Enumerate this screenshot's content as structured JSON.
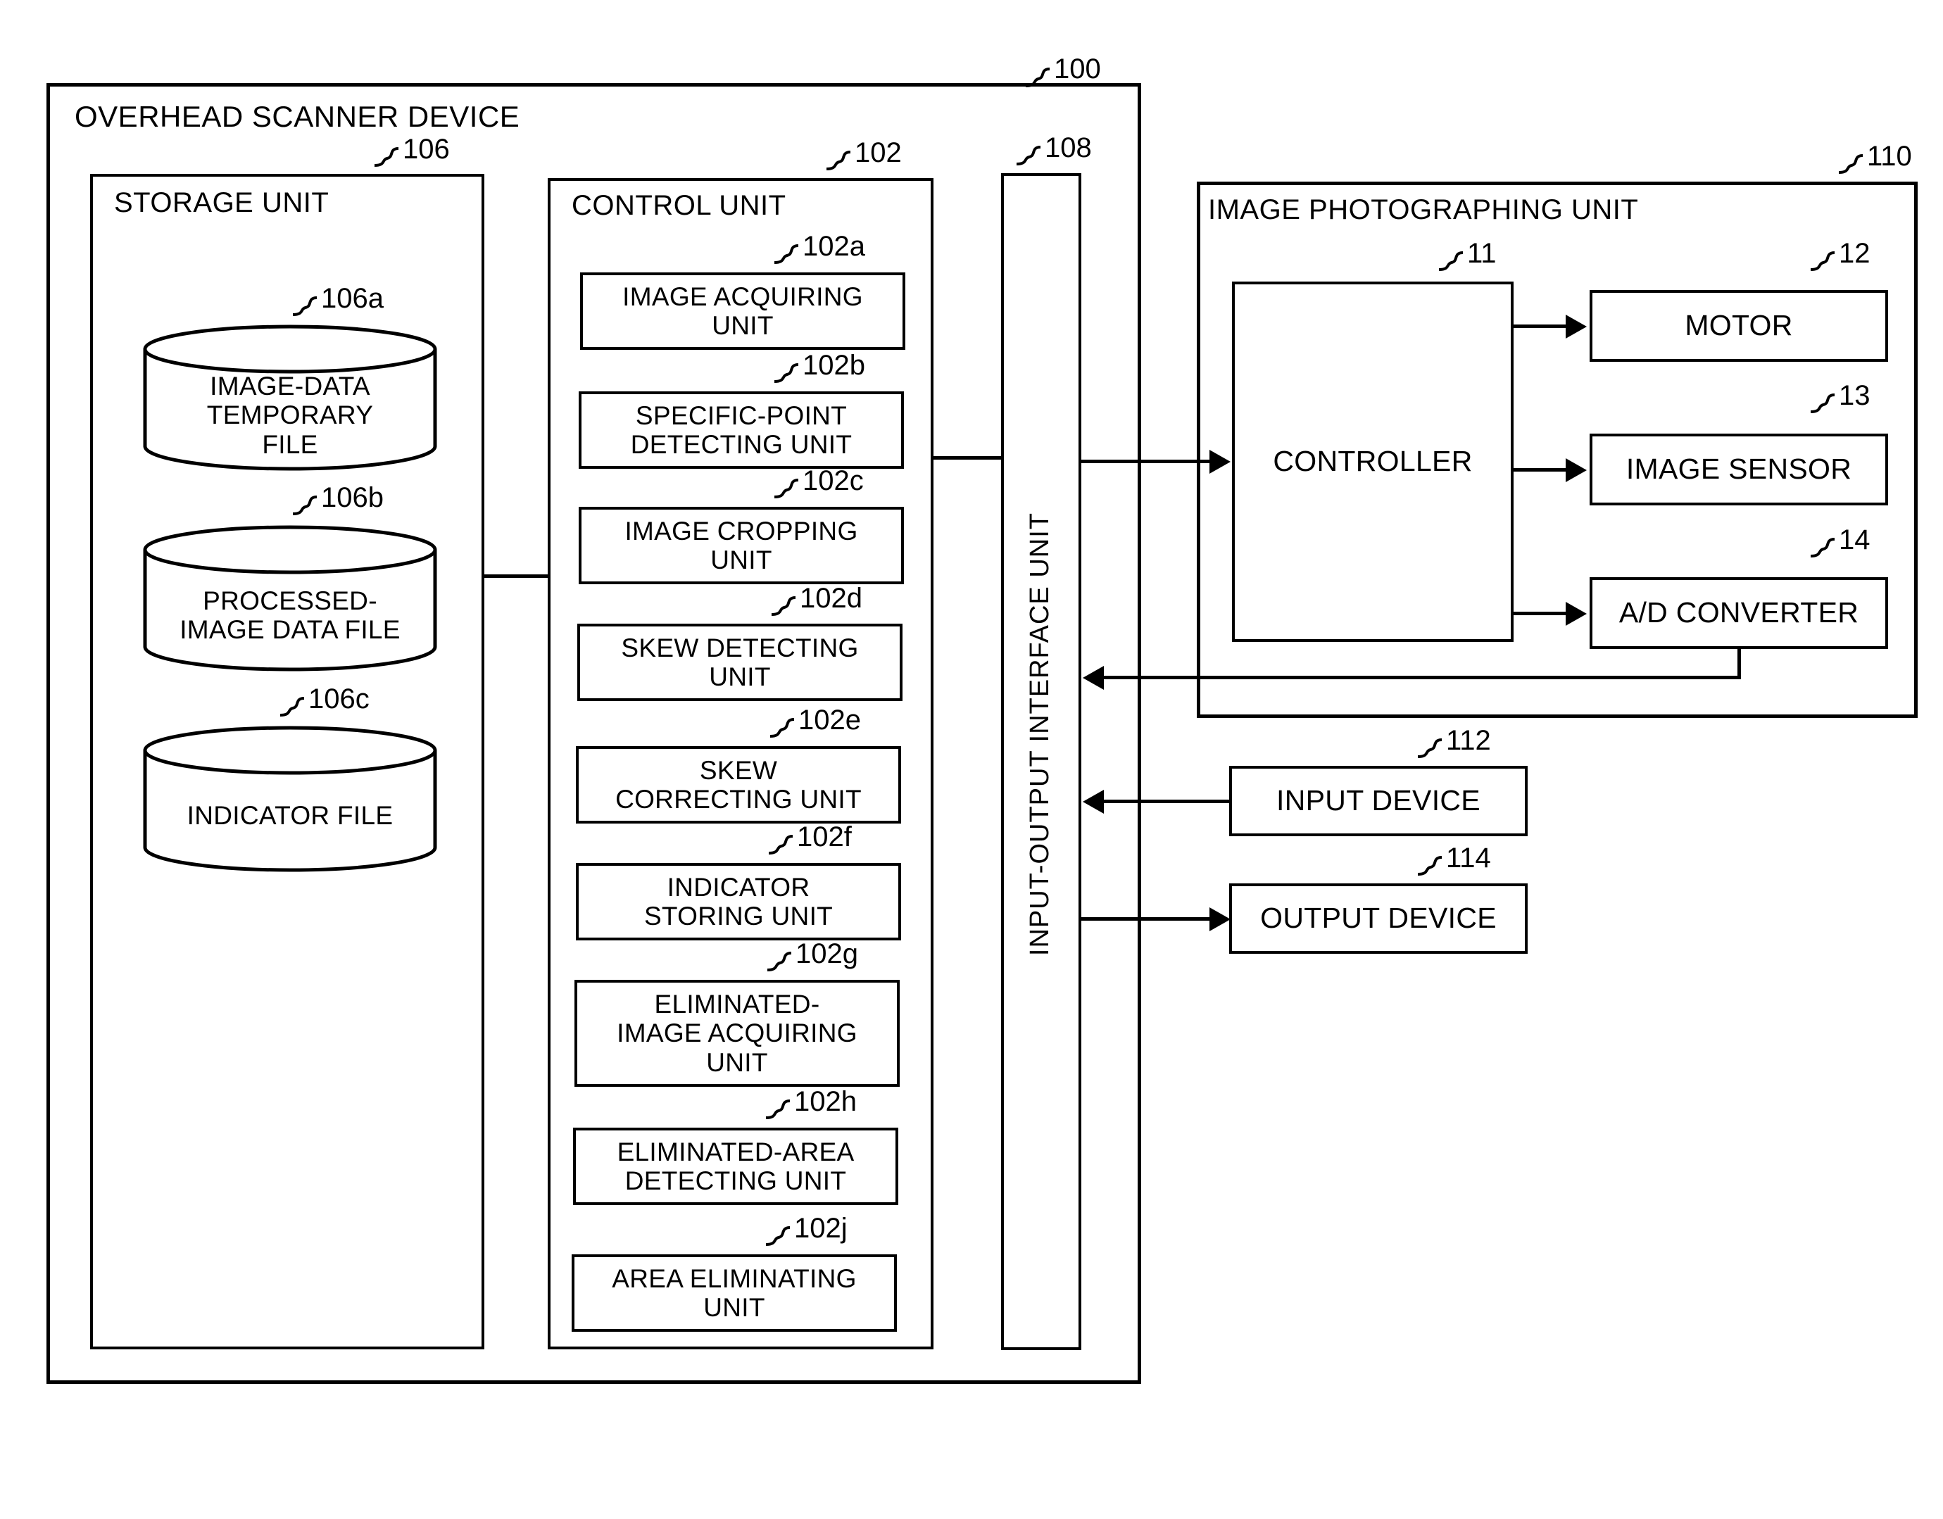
{
  "figure": {
    "type": "patent-block-diagram",
    "outer": {
      "ref": "100",
      "title": "OVERHEAD SCANNER DEVICE"
    },
    "storage_unit": {
      "ref": "106",
      "title": "STORAGE UNIT",
      "files": [
        {
          "ref": "106a",
          "label": "IMAGE-DATA\nTEMPORARY\nFILE",
          "lines": [
            "IMAGE-DATA",
            "TEMPORARY",
            "FILE"
          ]
        },
        {
          "ref": "106b",
          "label": "PROCESSED-\nIMAGE DATA FILE",
          "lines": [
            "PROCESSED-",
            "IMAGE DATA FILE"
          ]
        },
        {
          "ref": "106c",
          "label": "INDICATOR FILE",
          "lines": [
            "INDICATOR FILE"
          ]
        }
      ]
    },
    "control_unit": {
      "ref": "102",
      "title": "CONTROL UNIT",
      "units": [
        {
          "ref": "102a",
          "lines": [
            "IMAGE ACQUIRING",
            "UNIT"
          ]
        },
        {
          "ref": "102b",
          "lines": [
            "SPECIFIC-POINT",
            "DETECTING UNIT"
          ]
        },
        {
          "ref": "102c",
          "lines": [
            "IMAGE CROPPING",
            "UNIT"
          ]
        },
        {
          "ref": "102d",
          "lines": [
            "SKEW DETECTING",
            "UNIT"
          ]
        },
        {
          "ref": "102e",
          "lines": [
            "SKEW",
            "CORRECTING UNIT"
          ]
        },
        {
          "ref": "102f",
          "lines": [
            "INDICATOR",
            "STORING UNIT"
          ]
        },
        {
          "ref": "102g",
          "lines": [
            "ELIMINATED-",
            "IMAGE ACQUIRING",
            "UNIT"
          ]
        },
        {
          "ref": "102h",
          "lines": [
            "ELIMINATED-AREA",
            "DETECTING UNIT"
          ]
        },
        {
          "ref": "102j",
          "lines": [
            "AREA ELIMINATING",
            "UNIT"
          ]
        }
      ]
    },
    "io_interface": {
      "ref": "108",
      "title": "INPUT-OUTPUT INTERFACE UNIT"
    },
    "photographing_unit": {
      "ref": "110",
      "title": "IMAGE PHOTOGRAPHING UNIT",
      "controller": {
        "ref": "11",
        "label": "CONTROLLER"
      },
      "peripherals": [
        {
          "ref": "12",
          "label": "MOTOR"
        },
        {
          "ref": "13",
          "label": "IMAGE SENSOR"
        },
        {
          "ref": "14",
          "label": "A/D CONVERTER"
        }
      ]
    },
    "external_devices": [
      {
        "ref": "112",
        "label": "INPUT DEVICE"
      },
      {
        "ref": "114",
        "label": "OUTPUT DEVICE"
      }
    ]
  }
}
